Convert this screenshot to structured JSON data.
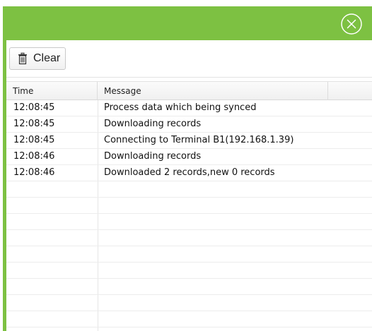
{
  "colors": {
    "accent": "#7dc142"
  },
  "titlebar": {
    "close_icon": "circle-x-icon"
  },
  "toolbar": {
    "clear_icon": "trash-icon",
    "clear_label": "Clear"
  },
  "grid": {
    "columns": [
      "Time",
      "Message"
    ],
    "rows": [
      {
        "time": "12:08:45",
        "message": "Process data which being synced"
      },
      {
        "time": "12:08:45",
        "message": "Downloading records"
      },
      {
        "time": "12:08:45",
        "message": "Connecting to Terminal B1(192.168.1.39)"
      },
      {
        "time": "12:08:46",
        "message": "Downloading records"
      },
      {
        "time": "12:08:46",
        "message": "Downloaded 2 records,new 0 records"
      }
    ]
  }
}
